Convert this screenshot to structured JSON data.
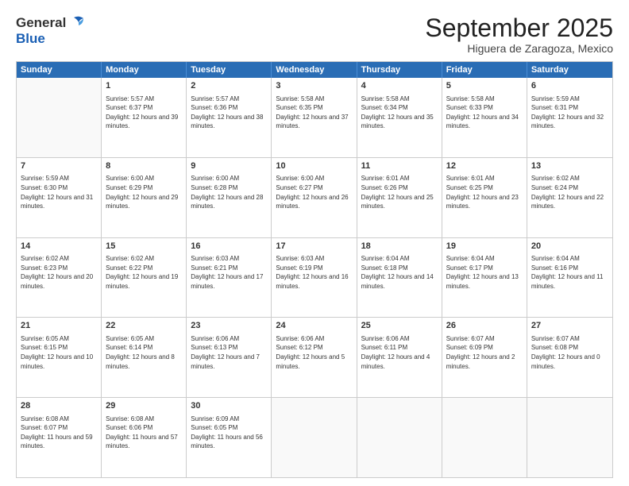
{
  "header": {
    "logo": {
      "general": "General",
      "blue": "Blue"
    },
    "title": "September 2025",
    "location": "Higuera de Zaragoza, Mexico"
  },
  "weekdays": [
    "Sunday",
    "Monday",
    "Tuesday",
    "Wednesday",
    "Thursday",
    "Friday",
    "Saturday"
  ],
  "rows": [
    [
      {
        "day": "",
        "empty": true
      },
      {
        "day": "1",
        "sunrise": "Sunrise: 5:57 AM",
        "sunset": "Sunset: 6:37 PM",
        "daylight": "Daylight: 12 hours and 39 minutes."
      },
      {
        "day": "2",
        "sunrise": "Sunrise: 5:57 AM",
        "sunset": "Sunset: 6:36 PM",
        "daylight": "Daylight: 12 hours and 38 minutes."
      },
      {
        "day": "3",
        "sunrise": "Sunrise: 5:58 AM",
        "sunset": "Sunset: 6:35 PM",
        "daylight": "Daylight: 12 hours and 37 minutes."
      },
      {
        "day": "4",
        "sunrise": "Sunrise: 5:58 AM",
        "sunset": "Sunset: 6:34 PM",
        "daylight": "Daylight: 12 hours and 35 minutes."
      },
      {
        "day": "5",
        "sunrise": "Sunrise: 5:58 AM",
        "sunset": "Sunset: 6:33 PM",
        "daylight": "Daylight: 12 hours and 34 minutes."
      },
      {
        "day": "6",
        "sunrise": "Sunrise: 5:59 AM",
        "sunset": "Sunset: 6:31 PM",
        "daylight": "Daylight: 12 hours and 32 minutes."
      }
    ],
    [
      {
        "day": "7",
        "sunrise": "Sunrise: 5:59 AM",
        "sunset": "Sunset: 6:30 PM",
        "daylight": "Daylight: 12 hours and 31 minutes."
      },
      {
        "day": "8",
        "sunrise": "Sunrise: 6:00 AM",
        "sunset": "Sunset: 6:29 PM",
        "daylight": "Daylight: 12 hours and 29 minutes."
      },
      {
        "day": "9",
        "sunrise": "Sunrise: 6:00 AM",
        "sunset": "Sunset: 6:28 PM",
        "daylight": "Daylight: 12 hours and 28 minutes."
      },
      {
        "day": "10",
        "sunrise": "Sunrise: 6:00 AM",
        "sunset": "Sunset: 6:27 PM",
        "daylight": "Daylight: 12 hours and 26 minutes."
      },
      {
        "day": "11",
        "sunrise": "Sunrise: 6:01 AM",
        "sunset": "Sunset: 6:26 PM",
        "daylight": "Daylight: 12 hours and 25 minutes."
      },
      {
        "day": "12",
        "sunrise": "Sunrise: 6:01 AM",
        "sunset": "Sunset: 6:25 PM",
        "daylight": "Daylight: 12 hours and 23 minutes."
      },
      {
        "day": "13",
        "sunrise": "Sunrise: 6:02 AM",
        "sunset": "Sunset: 6:24 PM",
        "daylight": "Daylight: 12 hours and 22 minutes."
      }
    ],
    [
      {
        "day": "14",
        "sunrise": "Sunrise: 6:02 AM",
        "sunset": "Sunset: 6:23 PM",
        "daylight": "Daylight: 12 hours and 20 minutes."
      },
      {
        "day": "15",
        "sunrise": "Sunrise: 6:02 AM",
        "sunset": "Sunset: 6:22 PM",
        "daylight": "Daylight: 12 hours and 19 minutes."
      },
      {
        "day": "16",
        "sunrise": "Sunrise: 6:03 AM",
        "sunset": "Sunset: 6:21 PM",
        "daylight": "Daylight: 12 hours and 17 minutes."
      },
      {
        "day": "17",
        "sunrise": "Sunrise: 6:03 AM",
        "sunset": "Sunset: 6:19 PM",
        "daylight": "Daylight: 12 hours and 16 minutes."
      },
      {
        "day": "18",
        "sunrise": "Sunrise: 6:04 AM",
        "sunset": "Sunset: 6:18 PM",
        "daylight": "Daylight: 12 hours and 14 minutes."
      },
      {
        "day": "19",
        "sunrise": "Sunrise: 6:04 AM",
        "sunset": "Sunset: 6:17 PM",
        "daylight": "Daylight: 12 hours and 13 minutes."
      },
      {
        "day": "20",
        "sunrise": "Sunrise: 6:04 AM",
        "sunset": "Sunset: 6:16 PM",
        "daylight": "Daylight: 12 hours and 11 minutes."
      }
    ],
    [
      {
        "day": "21",
        "sunrise": "Sunrise: 6:05 AM",
        "sunset": "Sunset: 6:15 PM",
        "daylight": "Daylight: 12 hours and 10 minutes."
      },
      {
        "day": "22",
        "sunrise": "Sunrise: 6:05 AM",
        "sunset": "Sunset: 6:14 PM",
        "daylight": "Daylight: 12 hours and 8 minutes."
      },
      {
        "day": "23",
        "sunrise": "Sunrise: 6:06 AM",
        "sunset": "Sunset: 6:13 PM",
        "daylight": "Daylight: 12 hours and 7 minutes."
      },
      {
        "day": "24",
        "sunrise": "Sunrise: 6:06 AM",
        "sunset": "Sunset: 6:12 PM",
        "daylight": "Daylight: 12 hours and 5 minutes."
      },
      {
        "day": "25",
        "sunrise": "Sunrise: 6:06 AM",
        "sunset": "Sunset: 6:11 PM",
        "daylight": "Daylight: 12 hours and 4 minutes."
      },
      {
        "day": "26",
        "sunrise": "Sunrise: 6:07 AM",
        "sunset": "Sunset: 6:09 PM",
        "daylight": "Daylight: 12 hours and 2 minutes."
      },
      {
        "day": "27",
        "sunrise": "Sunrise: 6:07 AM",
        "sunset": "Sunset: 6:08 PM",
        "daylight": "Daylight: 12 hours and 0 minutes."
      }
    ],
    [
      {
        "day": "28",
        "sunrise": "Sunrise: 6:08 AM",
        "sunset": "Sunset: 6:07 PM",
        "daylight": "Daylight: 11 hours and 59 minutes."
      },
      {
        "day": "29",
        "sunrise": "Sunrise: 6:08 AM",
        "sunset": "Sunset: 6:06 PM",
        "daylight": "Daylight: 11 hours and 57 minutes."
      },
      {
        "day": "30",
        "sunrise": "Sunrise: 6:09 AM",
        "sunset": "Sunset: 6:05 PM",
        "daylight": "Daylight: 11 hours and 56 minutes."
      },
      {
        "day": "",
        "empty": true
      },
      {
        "day": "",
        "empty": true
      },
      {
        "day": "",
        "empty": true
      },
      {
        "day": "",
        "empty": true
      }
    ]
  ]
}
